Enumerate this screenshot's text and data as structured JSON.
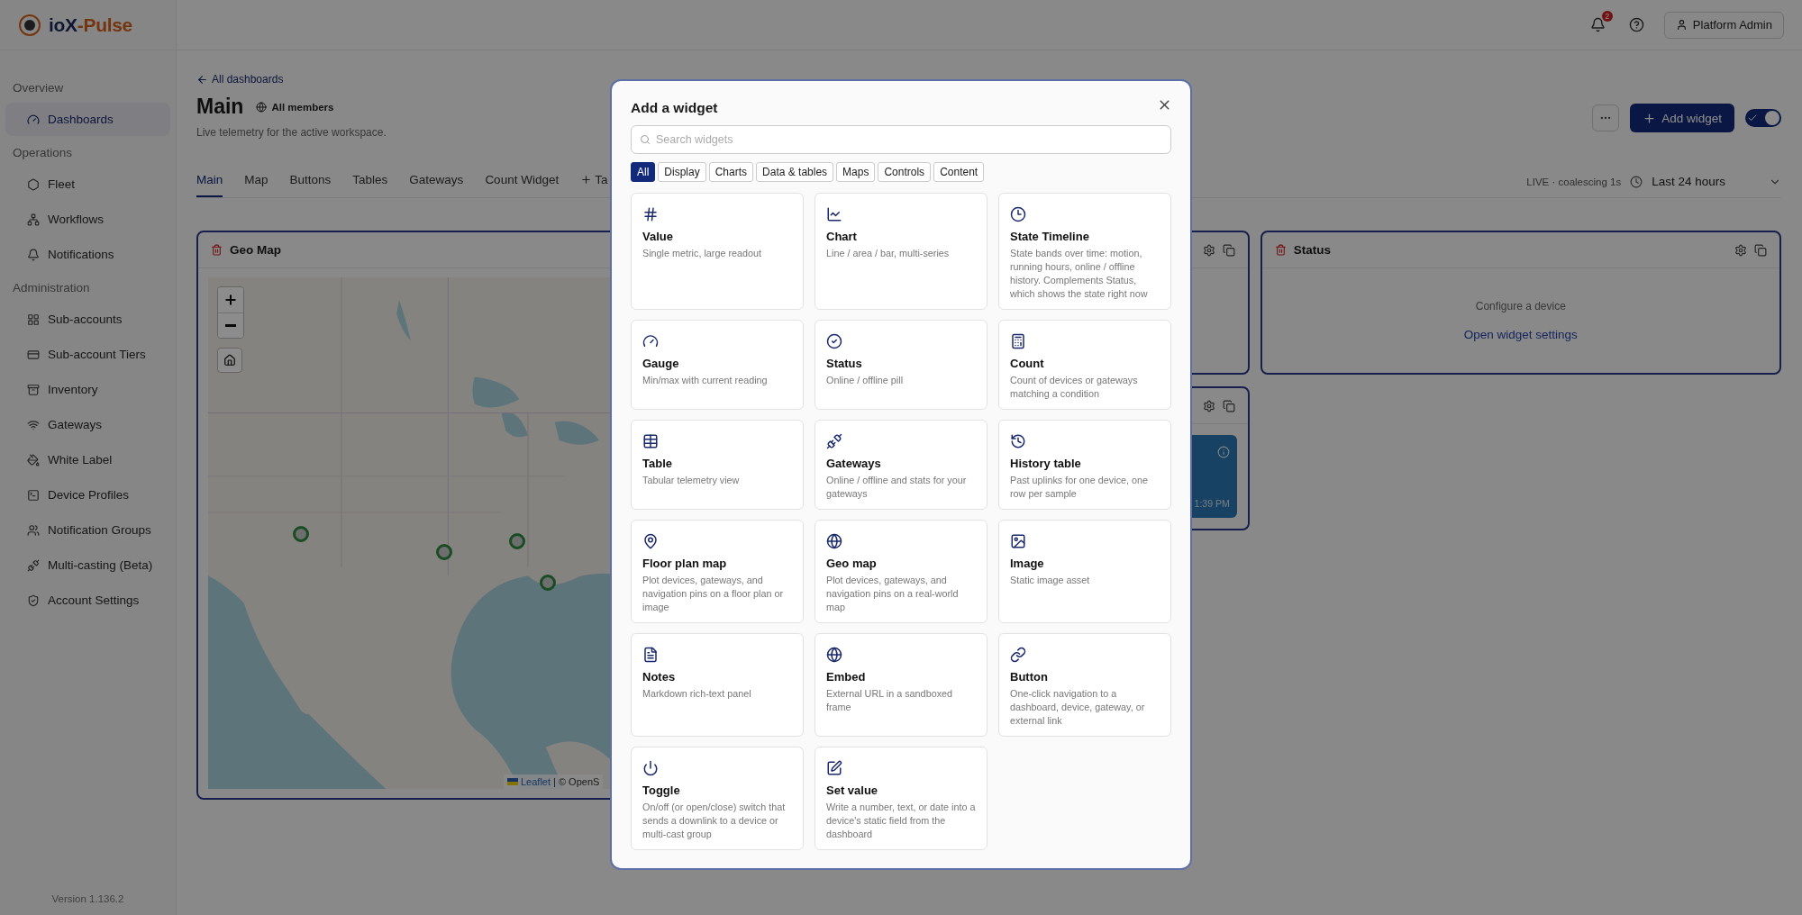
{
  "sidebar": {
    "logo": {
      "text": "ioX",
      "accent": "-Pulse"
    },
    "sections": [
      {
        "heading": "Overview",
        "items": [
          {
            "label": "Dashboards",
            "selected": true
          }
        ]
      },
      {
        "heading": "Operations",
        "items": [
          {
            "label": "Fleet",
            "selected": false
          },
          {
            "label": "Workflows",
            "selected": false
          },
          {
            "label": "Notifications",
            "selected": false
          }
        ]
      },
      {
        "heading": "Administration",
        "items": [
          {
            "label": "Sub-accounts",
            "selected": false
          },
          {
            "label": "Sub-account Tiers",
            "selected": false
          },
          {
            "label": "Inventory",
            "selected": false
          },
          {
            "label": "Gateways",
            "selected": false
          },
          {
            "label": "White Label",
            "selected": false
          },
          {
            "label": "Device Profiles",
            "selected": false
          },
          {
            "label": "Notification Groups",
            "selected": false
          },
          {
            "label": "Multi-casting (Beta)",
            "selected": false
          },
          {
            "label": "Account Settings",
            "selected": false
          }
        ]
      }
    ],
    "version": "Version 1.136.2"
  },
  "topbar": {
    "notification_count": "2",
    "user": "Platform Admin"
  },
  "page": {
    "back_link": "All dashboards",
    "title": "Main",
    "visibility": "All members",
    "subtitle": "Live telemetry for the active workspace.",
    "add_widget": "Add widget",
    "live_toggle": {
      "on": true
    }
  },
  "tabs": [
    {
      "label": "Main",
      "kind": "tab",
      "selected": true
    },
    {
      "label": "Map",
      "kind": "tab",
      "selected": false
    },
    {
      "label": "Buttons",
      "kind": "tab",
      "selected": false
    },
    {
      "label": "Tables",
      "kind": "tab",
      "selected": false
    },
    {
      "label": "Gateways",
      "kind": "tab",
      "selected": false
    },
    {
      "label": "Count Widget",
      "kind": "tab",
      "selected": false
    },
    {
      "label": "Ta",
      "kind": "add",
      "selected": false
    }
  ],
  "live_status": "LIVE · coalescing 1s",
  "time_range": "Last 24 hours",
  "widgets": [
    {
      "kind": "map",
      "title": "Geo Map",
      "attribution_link": "Leaflet",
      "attribution": "| © OpenS"
    },
    {
      "kind": "blank"
    },
    {
      "kind": "tile",
      "time": "1:39 PM"
    },
    {
      "kind": "status",
      "title": "Status",
      "message": "Configure a device",
      "link": "Open widget settings"
    }
  ],
  "dialog": {
    "title": "Add a widget",
    "search": {
      "placeholder": "Search widgets"
    },
    "filters": [
      {
        "label": "All",
        "selected": true
      },
      {
        "label": "Display",
        "selected": false
      },
      {
        "label": "Charts",
        "selected": false
      },
      {
        "label": "Data & tables",
        "selected": false
      },
      {
        "label": "Maps",
        "selected": false
      },
      {
        "label": "Controls",
        "selected": false
      },
      {
        "label": "Content",
        "selected": false
      }
    ],
    "widgets": [
      {
        "name": "Value",
        "description": "Single metric, large readout"
      },
      {
        "name": "Chart",
        "description": "Line / area / bar, multi-series"
      },
      {
        "name": "State Timeline",
        "description": "State bands over time: motion, running hours, online / offline history. Complements Status, which shows the state right now"
      },
      {
        "name": "Gauge",
        "description": "Min/max with current reading"
      },
      {
        "name": "Status",
        "description": "Online / offline pill"
      },
      {
        "name": "Count",
        "description": "Count of devices or gateways matching a condition"
      },
      {
        "name": "Table",
        "description": "Tabular telemetry view"
      },
      {
        "name": "Gateways",
        "description": "Online / offline and stats for your gateways"
      },
      {
        "name": "History table",
        "description": "Past uplinks for one device, one row per sample"
      },
      {
        "name": "Floor plan map",
        "description": "Plot devices, gateways, and navigation pins on a floor plan or image"
      },
      {
        "name": "Geo map",
        "description": "Plot devices, gateways, and navigation pins on a real-world map"
      },
      {
        "name": "Image",
        "description": "Static image asset"
      },
      {
        "name": "Notes",
        "description": "Markdown rich-text panel"
      },
      {
        "name": "Embed",
        "description": "External URL in a sandboxed frame"
      },
      {
        "name": "Button",
        "description": "One-click navigation to a dashboard, device, gateway, or external link"
      },
      {
        "name": "Toggle",
        "description": "On/off (or open/close) switch that sends a downlink to a device or multi-cast group"
      },
      {
        "name": "Set value",
        "description": "Write a number, text, or date into a device's static field from the dashboard"
      }
    ]
  }
}
